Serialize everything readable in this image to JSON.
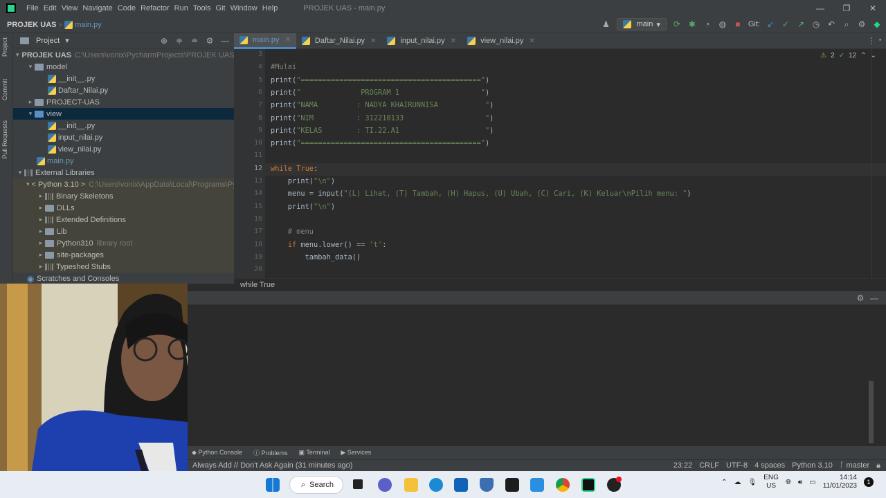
{
  "app": {
    "menu": [
      "File",
      "Edit",
      "View",
      "Navigate",
      "Code",
      "Refactor",
      "Run",
      "Tools",
      "Git",
      "Window",
      "Help"
    ],
    "window_title": "PROJEK UAS - main.py",
    "win_controls": [
      "—",
      "❐",
      "✕"
    ]
  },
  "navbar": {
    "project": "PROJEK UAS",
    "file": "main.py",
    "run_config": "main",
    "git_label": "Git:"
  },
  "left_strip": [
    "Project",
    "Commit",
    "Pull Requests"
  ],
  "project_panel": {
    "title": "Project",
    "rows": [
      {
        "label": "PROJEK UAS",
        "path": "C:\\Users\\vonix\\PycharmProjects\\PROJEK UAS"
      },
      {
        "label": "model"
      },
      {
        "label": "__init__.py"
      },
      {
        "label": "Daftar_Nilai.py"
      },
      {
        "label": "PROJECT-UAS"
      },
      {
        "label": "view"
      },
      {
        "label": "__init__.py"
      },
      {
        "label": "input_nilai.py"
      },
      {
        "label": "view_nilai.py"
      },
      {
        "label": "main.py"
      },
      {
        "label": "External Libraries"
      },
      {
        "label": "< Python 3.10 >",
        "path": "C:\\Users\\vonix\\AppData\\Local\\Programs\\Py"
      },
      {
        "label": "Binary Skeletons"
      },
      {
        "label": "DLLs"
      },
      {
        "label": "Extended Definitions"
      },
      {
        "label": "Lib"
      },
      {
        "label": "Python310",
        "path": "library root"
      },
      {
        "label": "site-packages"
      },
      {
        "label": "Typeshed Stubs"
      },
      {
        "label": "Scratches and Consoles"
      }
    ]
  },
  "editor": {
    "tabs": [
      "main.py",
      "Daftar_Nilai.py",
      "input_nilai.py",
      "view_nilai.py"
    ],
    "inspection": {
      "warnings": "2",
      "ok": "12"
    },
    "line_numbers": [
      "3",
      "4",
      "5",
      "6",
      "7",
      "8",
      "9",
      "10",
      "11",
      "12",
      "13",
      "14",
      "15",
      "16",
      "17",
      "18",
      "19",
      "20"
    ],
    "lines": [
      "",
      "#Mulai",
      "print(\"==========================================\")",
      "print(\"              PROGRAM 1                   \")",
      "print(\"NAMA         : NADYA KHAIRUNNISA           \")",
      "print(\"NIM          : 312210133                   \")",
      "print(\"KELAS        : TI.22.A1                    \")",
      "print(\"==========================================\")",
      "",
      "while True:",
      "    print(\"\\n\")",
      "    menu = input(\"(L) Lihat, (T) Tambah, (H) Hapus, (U) Ubah, (C) Cari, (K) Keluar\\nPilih menu: \")",
      "    print(\"\\n\")",
      "",
      "    # menu",
      "    if menu.lower() == 't':",
      "        tambah_data()",
      ""
    ],
    "breadcrumb": "while True"
  },
  "toolstrip": [
    "Python Console",
    "Problems",
    "Terminal",
    "Services"
  ],
  "statusbar": {
    "message": "Always Add // Don't Ask Again (31 minutes ago)",
    "position": "23:22",
    "line_sep": "CRLF",
    "encoding": "UTF-8",
    "indent": "4 spaces",
    "interpreter": "Python 3.10",
    "branch": "master"
  },
  "taskbar": {
    "search": "Search",
    "lang_top": "ENG",
    "lang_bottom": "US",
    "time": "14:14",
    "date": "11/01/2023",
    "badge": "1"
  },
  "colors": {
    "accent": "#4a88c7",
    "keyword": "#cc7832",
    "string": "#6a8759",
    "comment": "#808080"
  }
}
